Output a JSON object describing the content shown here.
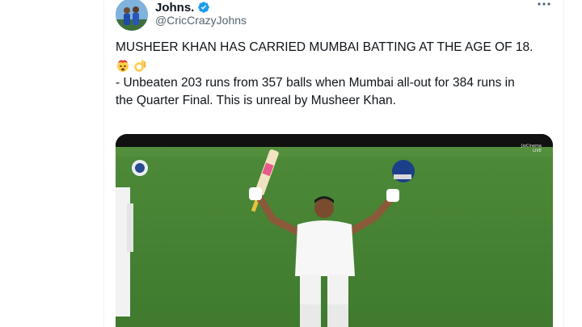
{
  "tweet": {
    "author": {
      "display_name": "Johns.",
      "handle": "@CricCrazyJohns",
      "verified": true,
      "avatar_icon": "profile-avatar"
    },
    "more_icon": "more-dots-icon",
    "text": {
      "line1": "MUSHEER KHAN HAS CARRIED MUMBAI BATTING AT THE AGE OF 18.",
      "emojis": [
        "exploding-head",
        "ok-hand"
      ],
      "line2": "- Unbeaten 203 runs from 357 balls when Mumbai all-out for 384 runs in",
      "line3": "the Quarter Final. This is unreal by Musheer Khan."
    },
    "media": {
      "broadcast_logo_line1": "JioCinema",
      "broadcast_logo_line2": "LIVE"
    }
  },
  "colors": {
    "verified_blue": "#1d9bf0",
    "field_green": "#4f8a3a",
    "text_secondary": "#536471"
  }
}
